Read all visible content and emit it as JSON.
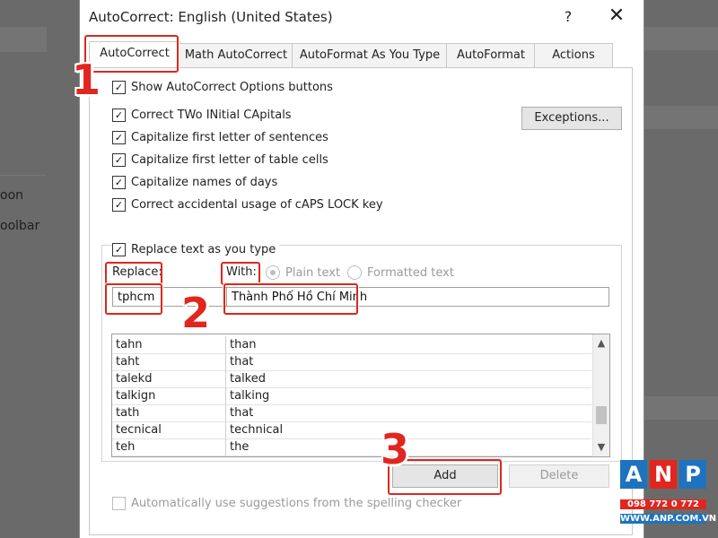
{
  "background": {
    "left_items": [
      "oon",
      "oolbar"
    ]
  },
  "dialog": {
    "title": "AutoCorrect: English (United States)",
    "help_glyph": "?",
    "close_glyph": "✕"
  },
  "tabs": [
    {
      "label": "AutoCorrect",
      "active": true
    },
    {
      "label": "Math AutoCorrect",
      "active": false
    },
    {
      "label": "AutoFormat As You Type",
      "active": false
    },
    {
      "label": "AutoFormat",
      "active": false
    },
    {
      "label": "Actions",
      "active": false
    }
  ],
  "options": {
    "show_buttons": "Show AutoCorrect Options buttons",
    "correct_two_initial": "Correct TWo INitial CApitals",
    "capitalize_sentences": "Capitalize first letter of sentences",
    "capitalize_table_cells": "Capitalize first letter of table cells",
    "capitalize_days": "Capitalize names of days",
    "correct_caps_lock": "Correct accidental usage of cAPS LOCK key",
    "replace_as_you_type": "Replace text as you type",
    "auto_suggestions": "Automatically use suggestions from the spelling checker",
    "checked_glyph": "✓"
  },
  "exceptions_button": "Exceptions...",
  "replace": {
    "replace_label": "Replace:",
    "with_label": "With:",
    "plain_text": "Plain text",
    "formatted_text": "Formatted text",
    "replace_value": "tphcm",
    "with_value": "Thành Phố Hồ Chí Minh"
  },
  "list": {
    "rows": [
      {
        "from": "tahn",
        "to": "than"
      },
      {
        "from": "taht",
        "to": "that"
      },
      {
        "from": "talekd",
        "to": "talked"
      },
      {
        "from": "talkign",
        "to": "talking"
      },
      {
        "from": "tath",
        "to": "that"
      },
      {
        "from": "tecnical",
        "to": "technical"
      },
      {
        "from": "teh",
        "to": "the"
      }
    ],
    "scroll_up": "▲",
    "scroll_down": "▼"
  },
  "buttons": {
    "add": "Add",
    "delete": "Delete"
  },
  "annotations": {
    "step1": "1",
    "step2": "2",
    "step3": "3",
    "color": "#e0261e"
  },
  "logo": {
    "letters": [
      "A",
      "N",
      "P"
    ],
    "letter_colors": [
      "#1e73be",
      "#e0261e",
      "#1e73be"
    ],
    "phone": "098 772 0 772",
    "url": "WWW.ANP.COM.VN"
  }
}
